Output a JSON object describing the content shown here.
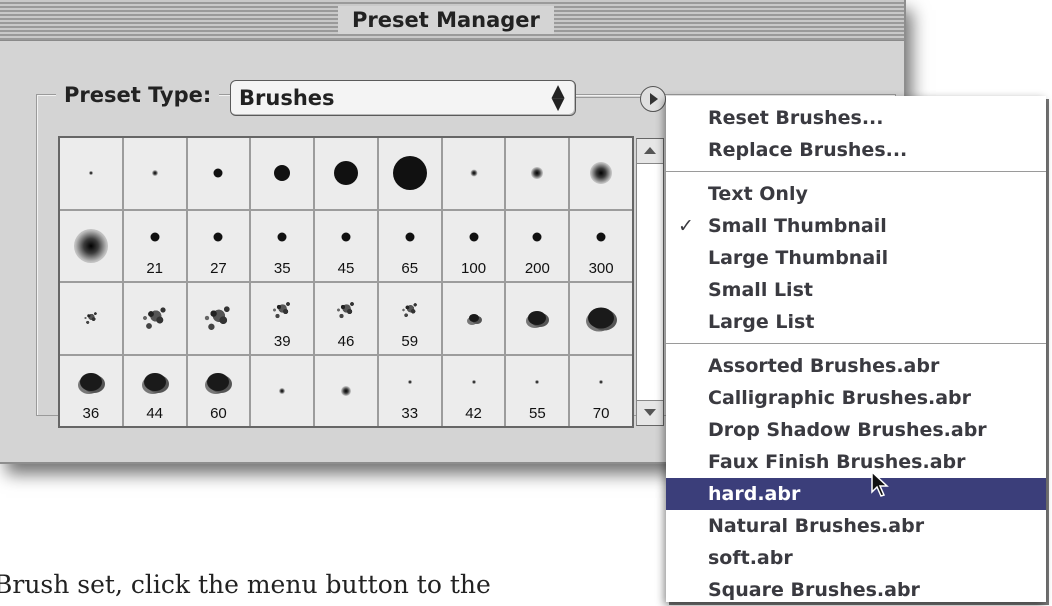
{
  "window": {
    "title": "Preset Manager",
    "preset_type_label": "Preset Type:",
    "preset_type_value": "Brushes"
  },
  "brush_grid": {
    "rows": [
      [
        "",
        "",
        "",
        "",
        "",
        "",
        "",
        "",
        ""
      ],
      [
        "",
        "21",
        "27",
        "35",
        "45",
        "65",
        "100",
        "200",
        "300"
      ],
      [
        "",
        "",
        "",
        "39",
        "46",
        "59",
        "",
        "",
        ""
      ],
      [
        "36",
        "44",
        "60",
        "",
        "",
        "33",
        "42",
        "55",
        "70"
      ]
    ]
  },
  "menu": {
    "group1": [
      "Reset Brushes...",
      "Replace Brushes..."
    ],
    "group2": [
      "Text Only",
      "Small Thumbnail",
      "Large Thumbnail",
      "Small List",
      "Large List"
    ],
    "group3": [
      "Assorted Brushes.abr",
      "Calligraphic Brushes.abr",
      "Drop Shadow Brushes.abr",
      "Faux Finish Brushes.abr",
      "hard.abr",
      "Natural Brushes.abr",
      "soft.abr",
      "Square Brushes.abr"
    ],
    "checked_item": "Small Thumbnail",
    "highlighted_item": "hard.abr",
    "check_mark": "✓"
  },
  "caption": "Brush set, click the menu button to the",
  "colors": {
    "highlight": "#3b3e7a",
    "window_bg": "#d4d4d4"
  }
}
